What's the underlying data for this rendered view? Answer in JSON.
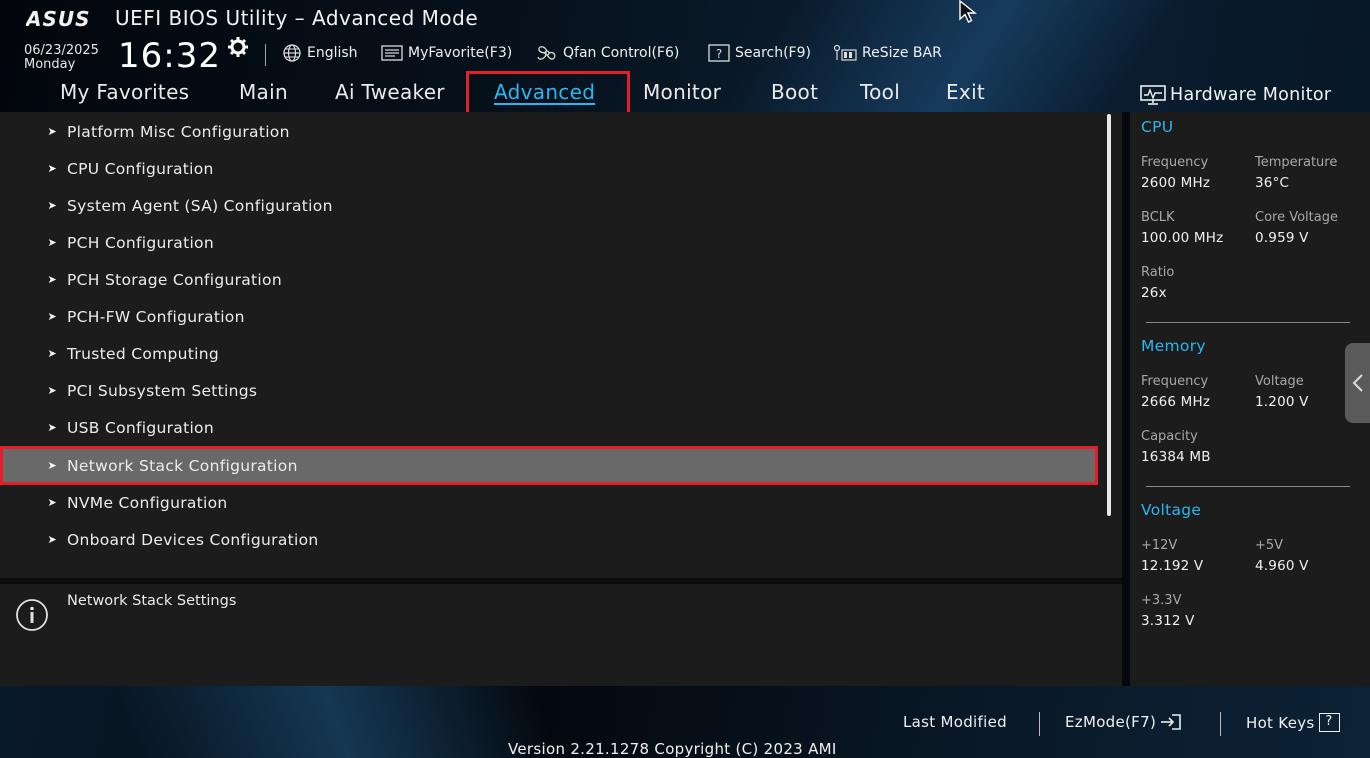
{
  "header": {
    "logo_text": "ASUS",
    "title": "UEFI BIOS Utility – Advanced Mode",
    "date": "06/23/2025",
    "day": "Monday",
    "time": "16:32",
    "toolbar": {
      "language": "English",
      "myfavorite": "MyFavorite(F3)",
      "qfan": "Qfan Control(F6)",
      "search": "Search(F9)",
      "resizebar": "ReSize BAR"
    }
  },
  "tabs": [
    "My Favorites",
    "Main",
    "Ai Tweaker",
    "Advanced",
    "Monitor",
    "Boot",
    "Tool",
    "Exit"
  ],
  "active_tab": "Advanced",
  "menu": {
    "items": [
      "Platform Misc Configuration",
      "CPU Configuration",
      "System Agent (SA) Configuration",
      "PCH Configuration",
      "PCH Storage Configuration",
      "PCH-FW Configuration",
      "Trusted Computing",
      "PCI Subsystem Settings",
      "USB Configuration",
      "Network Stack Configuration",
      "NVMe Configuration",
      "Onboard Devices Configuration"
    ],
    "selected": "Network Stack Configuration"
  },
  "help": {
    "text": "Network Stack Settings"
  },
  "hardware_monitor": {
    "title": "Hardware Monitor",
    "cpu": {
      "heading": "CPU",
      "frequency_label": "Frequency",
      "frequency_value": "2600 MHz",
      "temperature_label": "Temperature",
      "temperature_value": "36°C",
      "bclk_label": "BCLK",
      "bclk_value": "100.00 MHz",
      "core_voltage_label": "Core Voltage",
      "core_voltage_value": "0.959 V",
      "ratio_label": "Ratio",
      "ratio_value": "26x"
    },
    "memory": {
      "heading": "Memory",
      "frequency_label": "Frequency",
      "frequency_value": "2666 MHz",
      "voltage_label": "Voltage",
      "voltage_value": "1.200 V",
      "capacity_label": "Capacity",
      "capacity_value": "16384 MB"
    },
    "voltage": {
      "heading": "Voltage",
      "v12_label": "+12V",
      "v12_value": "12.192 V",
      "v5_label": "+5V",
      "v5_value": "4.960 V",
      "v33_label": "+3.3V",
      "v33_value": "3.312 V"
    }
  },
  "footer": {
    "last_modified": "Last Modified",
    "ezmode": "EzMode(F7)",
    "hotkeys": "Hot Keys",
    "hotkeys_symbol": "?",
    "version": "Version 2.21.1278 Copyright (C) 2023 AMI"
  },
  "colors": {
    "accent": "#2ab6f0",
    "highlight_box": "#e51f2a",
    "panel_bg": "#1c1c1c",
    "selected_row": "#696969"
  }
}
